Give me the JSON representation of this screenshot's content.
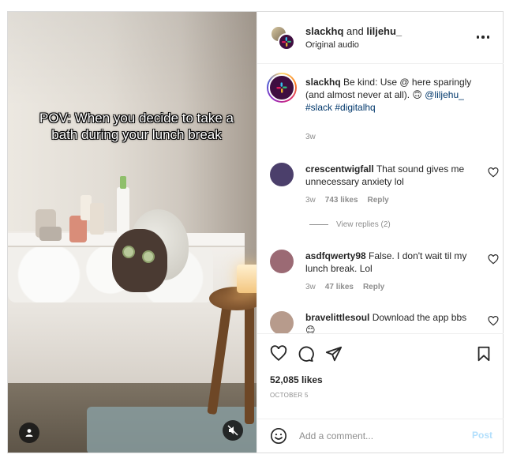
{
  "media": {
    "overlay_text": "POV: When you decide to take a bath during your lunch break",
    "user_tag_icon": "person-icon",
    "mute_icon": "volume-muted-icon"
  },
  "header": {
    "owner": "slackhq",
    "and_text": "and",
    "collaborator": "liljehu_",
    "audio": "Original audio",
    "more_icon": "more-horizontal-icon"
  },
  "caption": {
    "username": "slackhq",
    "text": "Be kind: Use @ here sparingly (and almost never at all). 🙃",
    "mention": "@liljehu_",
    "hashtags": "#slack #digitalhq",
    "time": "3w"
  },
  "comments": [
    {
      "username": "crescentwigfall",
      "text": "That sound gives me unnecessary anxiety lol",
      "time": "3w",
      "likes": "743 likes",
      "reply": "Reply",
      "avatar_color": "#4b3f6b"
    },
    {
      "username": "asdfqwerty98",
      "text": "False. I don't wait til my lunch break. Lol",
      "time": "3w",
      "likes": "47 likes",
      "reply": "Reply",
      "avatar_color": "#9b6a74"
    },
    {
      "username": "bravelittlesoul",
      "text": "Download the app bbs 😊",
      "time": "",
      "likes": "",
      "reply": "",
      "avatar_color": "#b79b8c"
    }
  ],
  "view_replies": "View replies (2)",
  "actions": {
    "like_icon": "heart-icon",
    "comment_icon": "comment-icon",
    "share_icon": "send-icon",
    "save_icon": "bookmark-icon"
  },
  "likes_count": "52,085 likes",
  "date": "OCTOBER 5",
  "add_comment": {
    "placeholder": "Add a comment...",
    "post_label": "Post",
    "emoji_icon": "smiley-icon"
  },
  "colors": {
    "link": "#00376b",
    "muted": "#8e8e8e",
    "post_disabled": "#b2dffc",
    "slack_purple": "#3f0e40"
  }
}
